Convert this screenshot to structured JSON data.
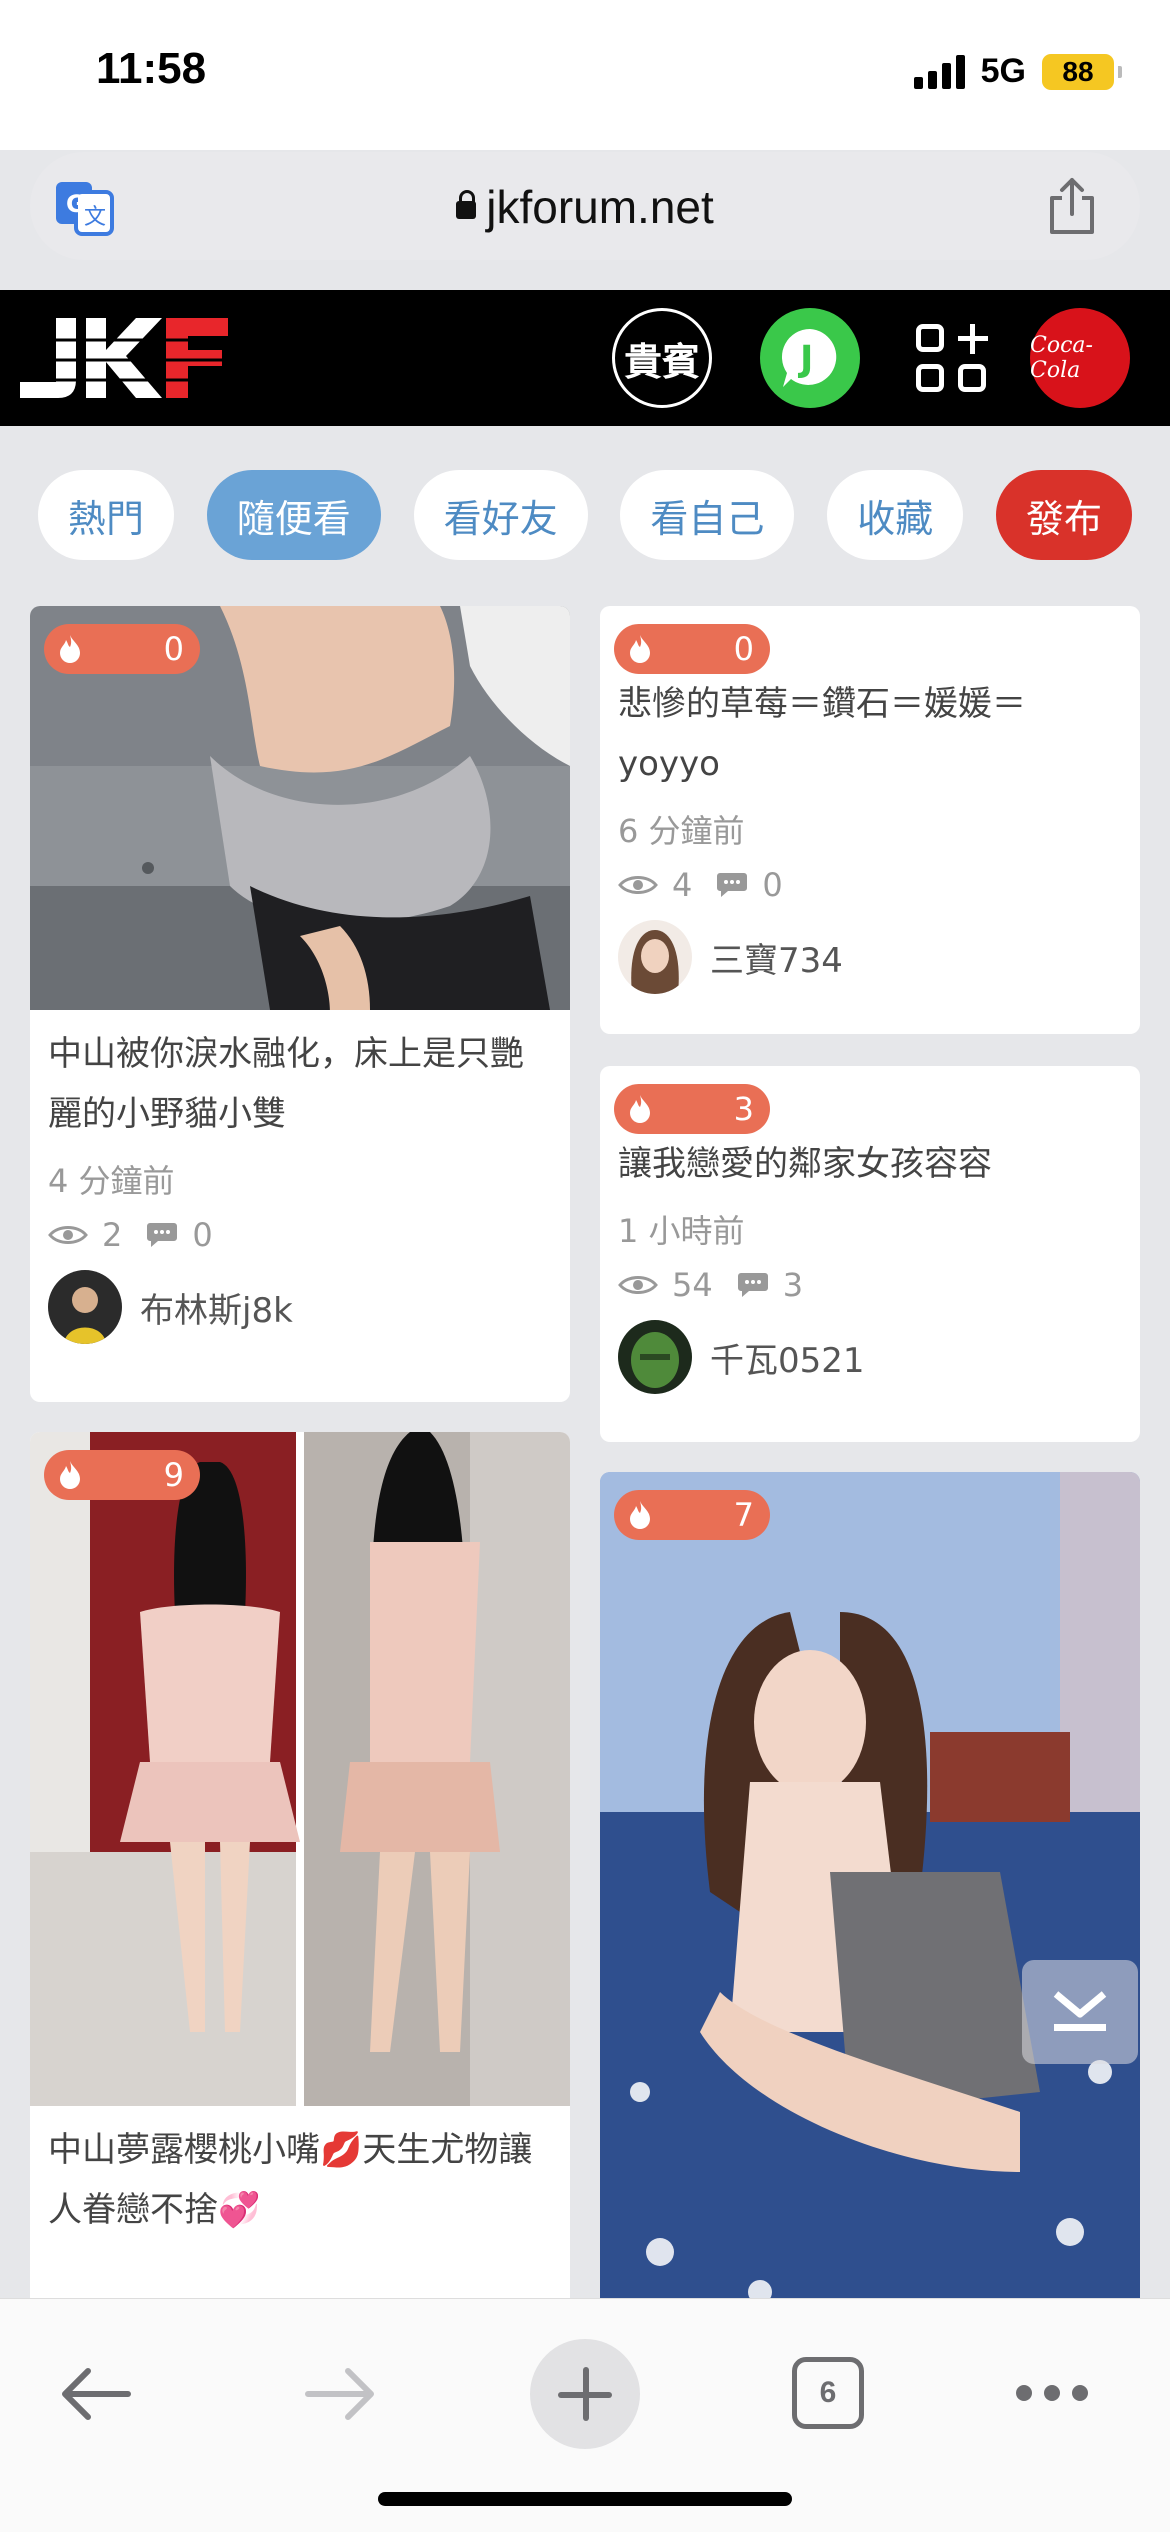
{
  "status_bar": {
    "time": "11:58",
    "network": "5G",
    "battery": "88"
  },
  "browser": {
    "url": "jkforum.net",
    "tab_count": "6"
  },
  "header": {
    "logo": "JKF",
    "vip_label": "貴賓",
    "line_icon_label": "J",
    "sponsor_label": "Coca-Cola"
  },
  "tabs": [
    {
      "label": "熱門"
    },
    {
      "label": "隨便看",
      "active": true
    },
    {
      "label": "看好友"
    },
    {
      "label": "看自己"
    },
    {
      "label": "收藏"
    },
    {
      "label": "發布"
    }
  ],
  "posts": [
    {
      "hot": "0",
      "title": "中山被你淚水融化，床上是只艷麗的小野貓小雙",
      "ago": "4 分鐘前",
      "views": "2",
      "comments": "0",
      "author": "布林斯j8k"
    },
    {
      "hot": "0",
      "title": "悲慘的草莓＝鑽石＝媛媛＝yoyyo",
      "ago": "6 分鐘前",
      "views": "4",
      "comments": "0",
      "author": "三寶734"
    },
    {
      "hot": "3",
      "title": "讓我戀愛的鄰家女孩容容",
      "ago": "1 小時前",
      "views": "54",
      "comments": "3",
      "author": "千瓦0521"
    },
    {
      "hot": "9",
      "title": "中山夢露櫻桃小嘴💋天生尤物讓人眷戀不捨💞"
    },
    {
      "hot": "7"
    }
  ],
  "colors": {
    "accent_blue": "#6aa3d6",
    "publish_red": "#d9322a",
    "badge_orange": "#e96f55",
    "line_green": "#3ac84a"
  }
}
